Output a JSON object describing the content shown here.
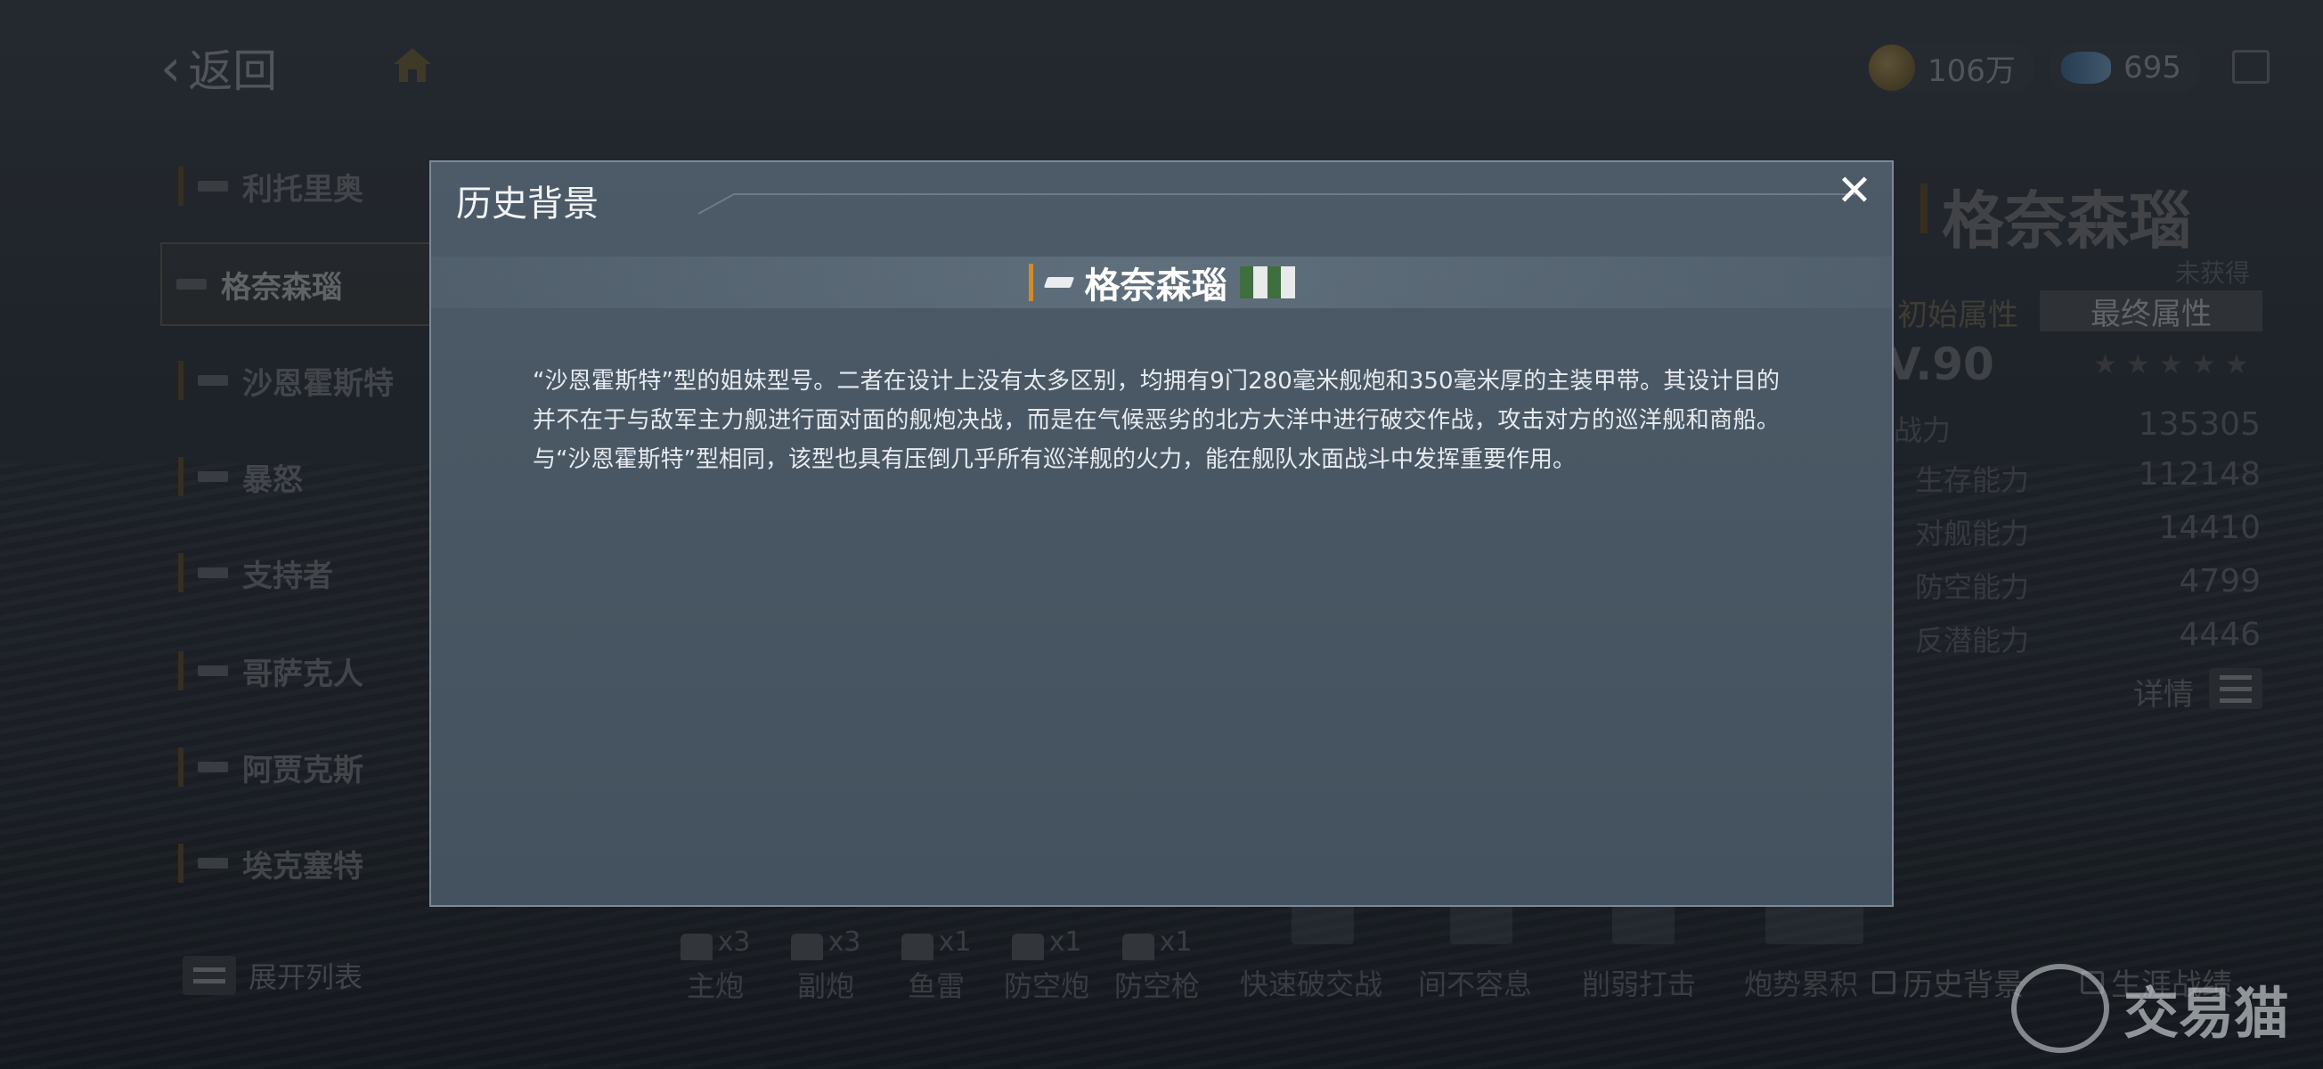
{
  "topbar": {
    "back_label": "返回",
    "gold_value": "106万",
    "diamond_value": "695"
  },
  "ship_list": [
    {
      "name": "利托里奥"
    },
    {
      "name": "格奈森瑙"
    },
    {
      "name": "沙恩霍斯特"
    },
    {
      "name": "暴怒"
    },
    {
      "name": "支持者"
    },
    {
      "name": "哥萨克人"
    },
    {
      "name": "阿贾克斯"
    },
    {
      "name": "埃克塞特"
    }
  ],
  "expand_list_label": "展开列表",
  "right_panel": {
    "ship_name": "格奈森瑙",
    "status": "未获得",
    "tab_initial": "初始属性",
    "tab_final": "最终属性",
    "level": "V.90",
    "stats": [
      {
        "label": "战力",
        "value": "135305"
      },
      {
        "label": "生存能力",
        "value": "112148"
      },
      {
        "label": "对舰能力",
        "value": "14410"
      },
      {
        "label": "防空能力",
        "value": "4799"
      },
      {
        "label": "反潜能力",
        "value": "4446"
      }
    ],
    "detail_label": "详情"
  },
  "bottom_bar": {
    "weapons": [
      {
        "label": "主炮",
        "count": "x3"
      },
      {
        "label": "副炮",
        "count": "x3"
      },
      {
        "label": "鱼雷",
        "count": "x1"
      },
      {
        "label": "防空炮",
        "count": "x1"
      },
      {
        "label": "防空枪",
        "count": "x1"
      }
    ],
    "skills": [
      "快速破交战",
      "间不容息",
      "削弱打击",
      "炮势累积"
    ],
    "history_link": "历史背景",
    "career_link": "生涯战绩"
  },
  "watermark": "交易猫",
  "modal": {
    "title": "历史背景",
    "ship_name": "格奈森瑙",
    "description": "“沙恩霍斯特”型的姐妹型号。二者在设计上没有太多区别，均拥有9门280毫米舰炮和350毫米厚的主装甲带。其设计目的并不在于与敌军主力舰进行面对面的舰炮决战，而是在气候恶劣的北方大洋中进行破交作战，攻击对方的巡洋舰和商船。与“沙恩霍斯特”型相同，该型也具有压倒几乎所有巡洋舰的火力，能在舰队水面战斗中发挥重要作用。"
  },
  "colors": {
    "modal_bg": "#4a5865",
    "name_accent": "#d28b2b",
    "flag_green": "#3f6e3f"
  }
}
